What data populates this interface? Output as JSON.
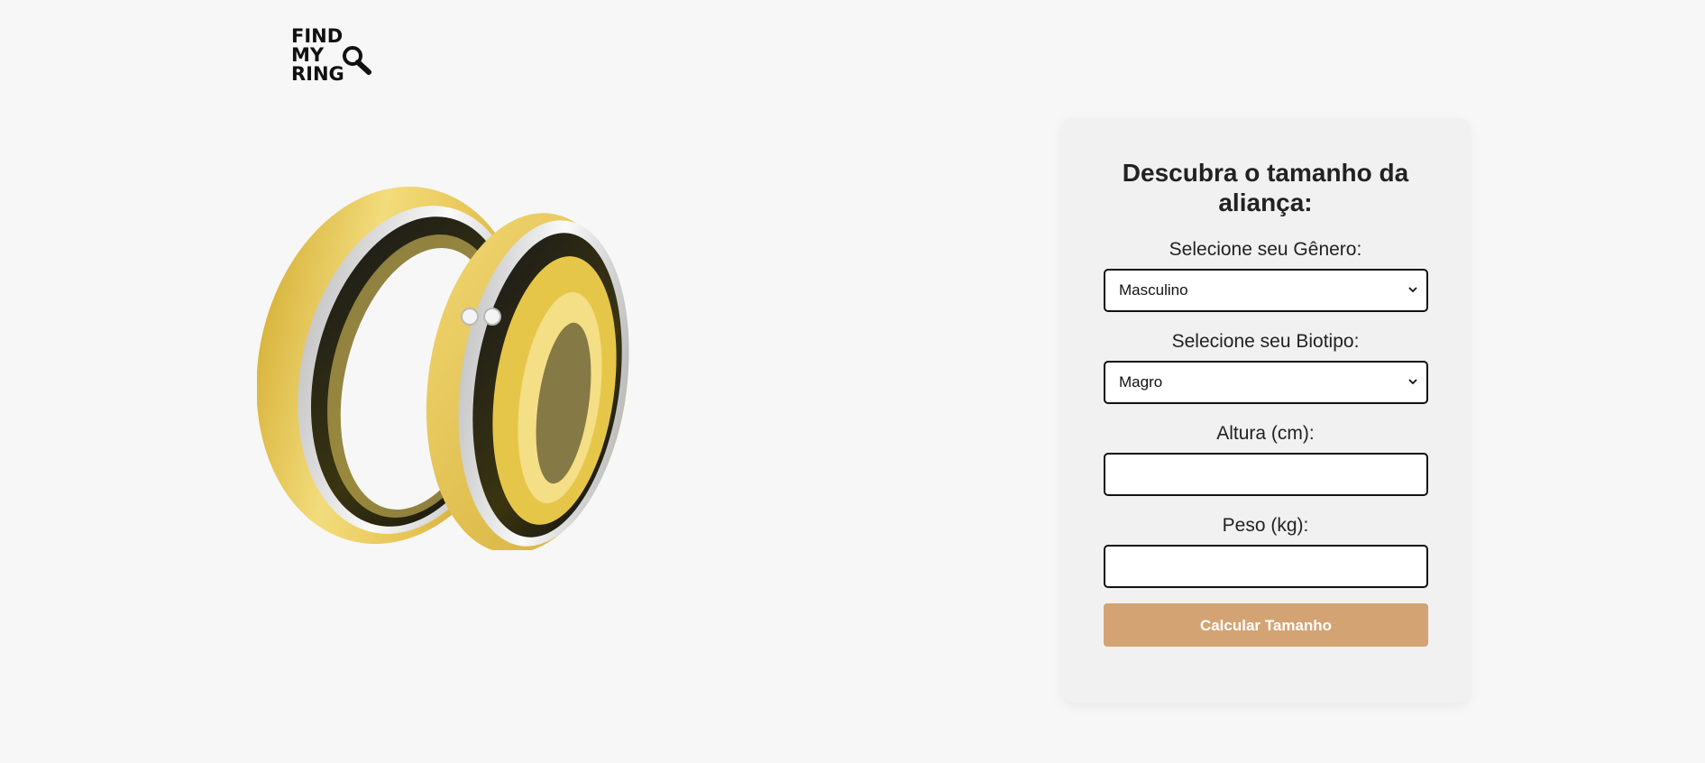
{
  "brand": {
    "logo_lines": [
      "FIND",
      "MY",
      "RING"
    ],
    "logo_icon": "magnifier-icon"
  },
  "hero": {
    "image": "wedding-rings-image"
  },
  "form": {
    "title": "Descubra o tamanho da aliança:",
    "gender": {
      "label": "Selecione seu Gênero:",
      "value": "Masculino",
      "icon": "chevron-down-icon"
    },
    "biotype": {
      "label": "Selecione seu Biotipo:",
      "value": "Magro",
      "icon": "chevron-down-icon"
    },
    "height": {
      "label": "Altura (cm):",
      "value": ""
    },
    "weight": {
      "label": "Peso (kg):",
      "value": ""
    },
    "submit_label": "Calcular Tamanho"
  },
  "colors": {
    "background": "#f7f7f7",
    "card": "#f1f1f1",
    "button": "#d4a373",
    "gold": "#e8c34a",
    "silver": "#e3e3e3"
  }
}
